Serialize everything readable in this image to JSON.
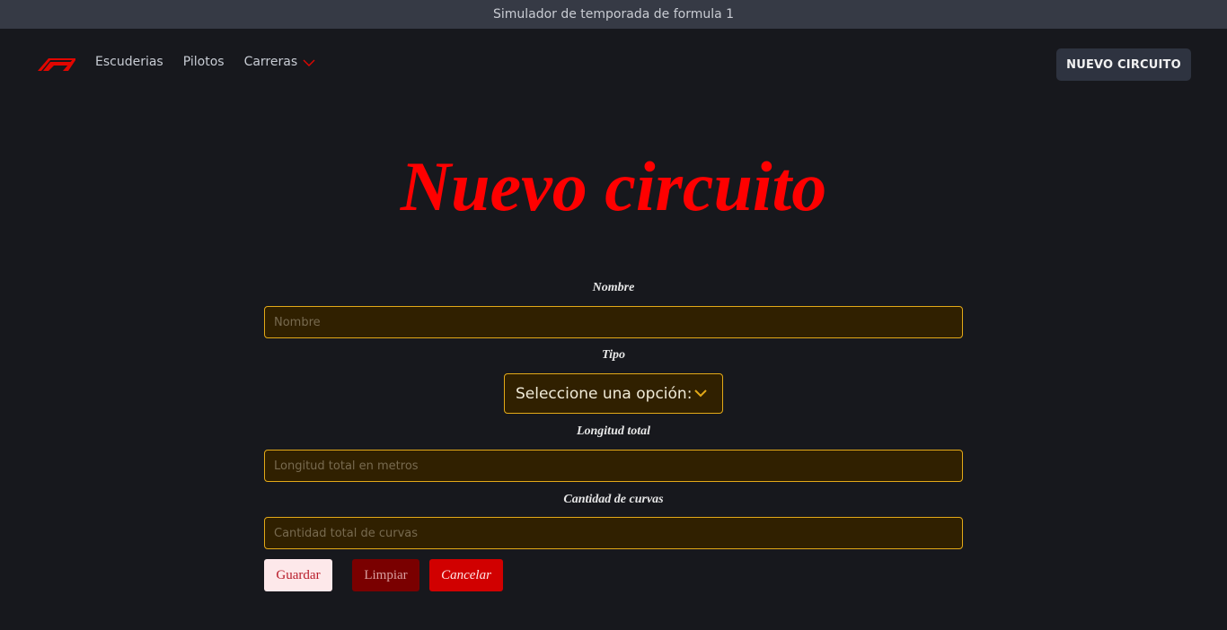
{
  "window": {
    "title": "Simulador de temporada de formula 1"
  },
  "nav": {
    "logo_icon": "f1-logo-icon",
    "links": [
      "Escuderias",
      "Pilotos"
    ],
    "dropdown_label": "Carreras",
    "dropdown_icon": "chevron-down-icon",
    "cta_label": "NUEVO CIRCUITO",
    "accent": "#e10600"
  },
  "page": {
    "title": "Nuevo circuito",
    "title_color": "#ff0000"
  },
  "form": {
    "nombre": {
      "label": "Nombre",
      "placeholder": "Nombre",
      "value": ""
    },
    "tipo": {
      "label": "Tipo",
      "selected": "Seleccione una opción:",
      "icon": "chevron-down-icon"
    },
    "longitud": {
      "label": "Longitud total",
      "placeholder": "Longitud total en metros",
      "value": ""
    },
    "curvas": {
      "label": "Cantidad de curvas",
      "placeholder": "Cantidad total de curvas",
      "value": ""
    },
    "buttons": {
      "save": "Guardar",
      "clear": "Limpiar",
      "cancel": "Cancelar"
    },
    "border_color": "#e3a918",
    "input_bg": "#302000"
  }
}
